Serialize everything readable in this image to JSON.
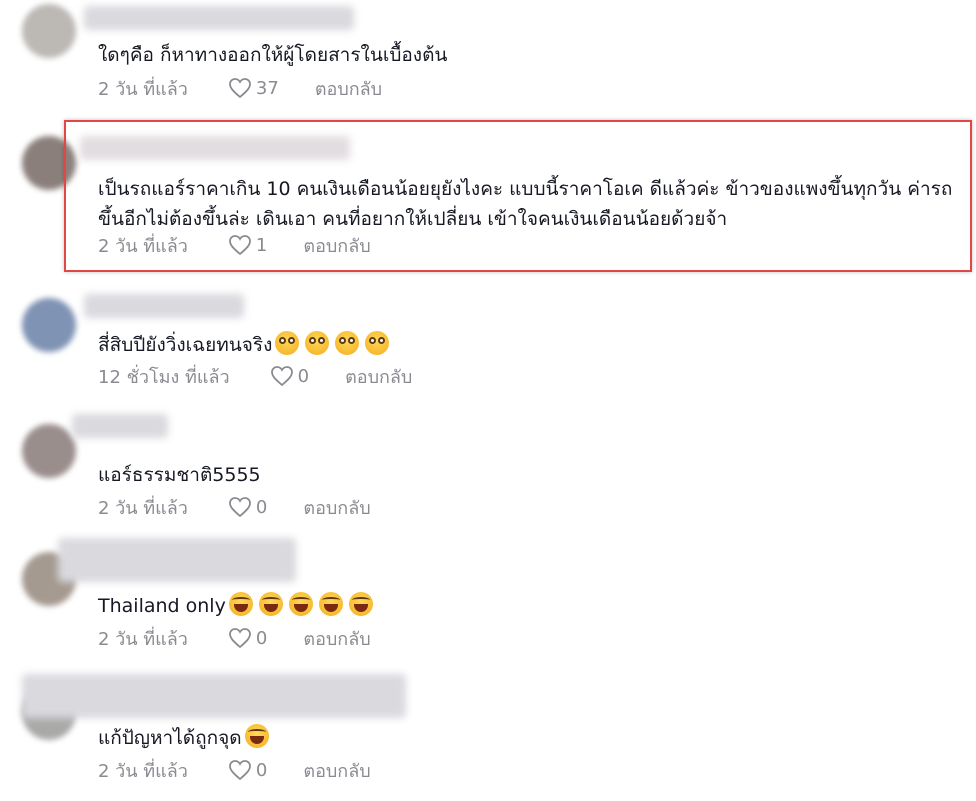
{
  "like_icon": "heart-outline-icon",
  "highlight_color": "#e04848",
  "comments": [
    {
      "text": "ใดๆคือ ก็หาทางออกให้ผู้โดยสารในเบื้องต้น",
      "time": "2 วัน ที่แล้ว",
      "likes": "37",
      "reply": "ตอบกลับ"
    },
    {
      "text": "เป็นรถแอร์ราคาเกิน 10 คนเงินเดือนน้อยยุยังไงคะ แบบนี้ราคาโอเค ดีแล้วค่ะ ข้าวของแพงขึ้นทุกวัน ค่ารถขึ้นอีกไม่ต้องขึ้นล่ะ เดินเอา คนที่อยากให้เปลี่ยน เข้าใจคนเงินเดือนน้อยด้วยจ้า",
      "time": "2 วัน ที่แล้ว",
      "likes": "1",
      "reply": "ตอบกลับ"
    },
    {
      "text": "สี่สิบปียังวิ่งเฉยทนจริง",
      "emoji": "flushed-face-emoji",
      "time": "12 ชั่วโมง ที่แล้ว",
      "likes": "0",
      "reply": "ตอบกลับ"
    },
    {
      "text": "แอร์ธรรมชาติ5555",
      "time": "2 วัน ที่แล้ว",
      "likes": "0",
      "reply": "ตอบกลับ"
    },
    {
      "text": "Thailand only",
      "emoji": "laughing-face-emoji",
      "time": "2 วัน ที่แล้ว",
      "likes": "0",
      "reply": "ตอบกลับ"
    },
    {
      "text": "แก้ปัญหาได้ถูกจุด",
      "emoji": "laughing-face-emoji",
      "time": "2 วัน ที่แล้ว",
      "likes": "0",
      "reply": "ตอบกลับ"
    }
  ]
}
